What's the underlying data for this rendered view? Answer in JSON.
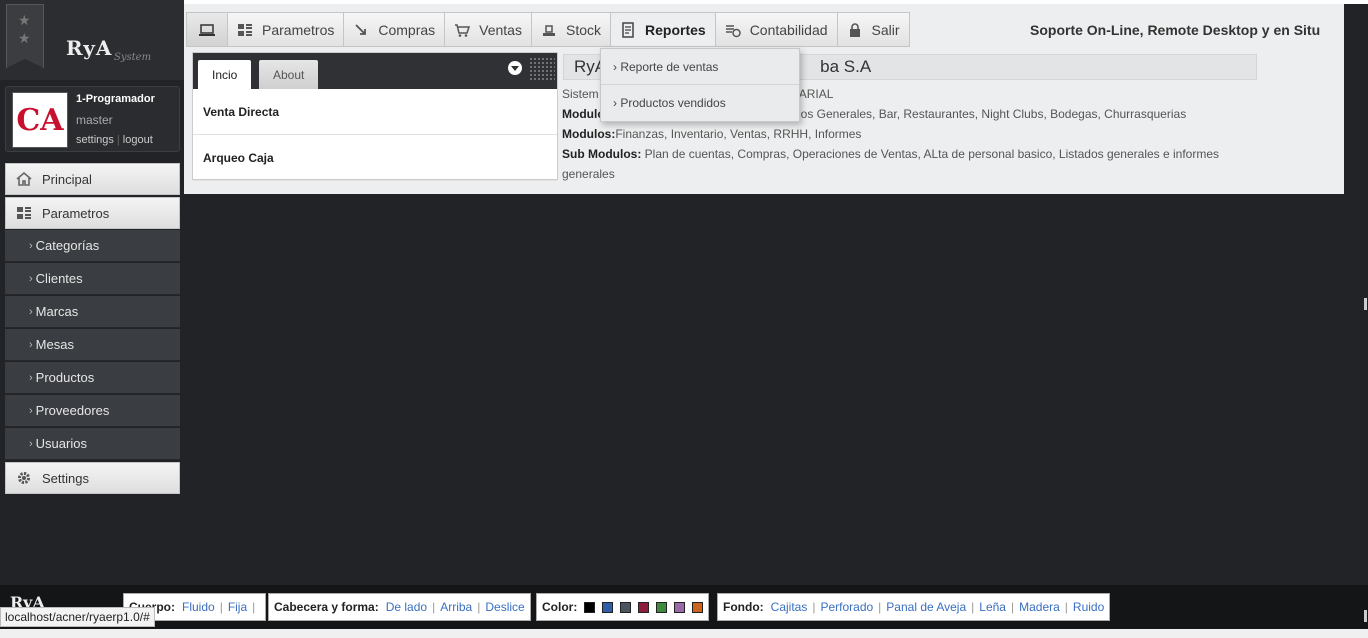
{
  "logo": {
    "text": "RyA",
    "sub": "System"
  },
  "user": {
    "name": "1-Programador",
    "role": "master",
    "settings": "settings",
    "logout": "logout",
    "avatar_text": "CA"
  },
  "sidebar": {
    "principal": "Principal",
    "parametros": "Parametros",
    "subitems": [
      "Categorías",
      "Clientes",
      "Marcas",
      "Mesas",
      "Productos",
      "Proveedores",
      "Usuarios"
    ],
    "settings": "Settings"
  },
  "nav": {
    "items": [
      "Parametros",
      "Compras",
      "Ventas",
      "Stock",
      "Reportes",
      "Contabilidad",
      "Salir"
    ],
    "support": "Soporte On-Line, Remote Desktop y en Situ"
  },
  "dropdown": {
    "items": [
      "› Reporte de ventas",
      "› Productos vendidos"
    ]
  },
  "widget": {
    "tab_inicio": "Incio",
    "tab_about": "About",
    "rows": [
      "Venta Directa",
      "Arqueo Caja"
    ]
  },
  "info": {
    "title_left": "RyA",
    "title_right": "ba S.A",
    "line1_left": "Sistem",
    "line1_right": "ARIAL",
    "line2_label": "Modulo",
    "line2_value": "os Generales, Bar, Restaurantes, Night Clubs, Bodegas, Churrasquerias",
    "line3_label": "Modulos:",
    "line3_value": "Finanzas, Inventario, Ventas, RRHH, Informes",
    "line4_label": "Sub Modulos:",
    "line4_value": "Plan de cuentas, Compras, Operaciones de Ventas, ALta de personal basico, Listados generales e informes",
    "line5_value": "generales"
  },
  "footer": {
    "logo": "RyA",
    "cuerpo_label": "Cuerpo:",
    "cuerpo_opts": [
      "Fluido",
      "Fija"
    ],
    "cabecera_label": "Cabecera y forma:",
    "cabecera_opts": [
      "De lado",
      "Arriba",
      "Deslice"
    ],
    "color_label": "Color:",
    "colors": [
      "#000000",
      "#2f5fa8",
      "#4a5560",
      "#8c1d3d",
      "#3f8a3f",
      "#9a6aa8",
      "#c9651e"
    ],
    "fondo_label": "Fondo:",
    "fondo_opts": [
      "Cajitas",
      "Perforado",
      "Panal de Aveja",
      "Leña",
      "Madera",
      "Ruido"
    ]
  },
  "status_url": "localhost/acner/ryaerp1.0/#"
}
